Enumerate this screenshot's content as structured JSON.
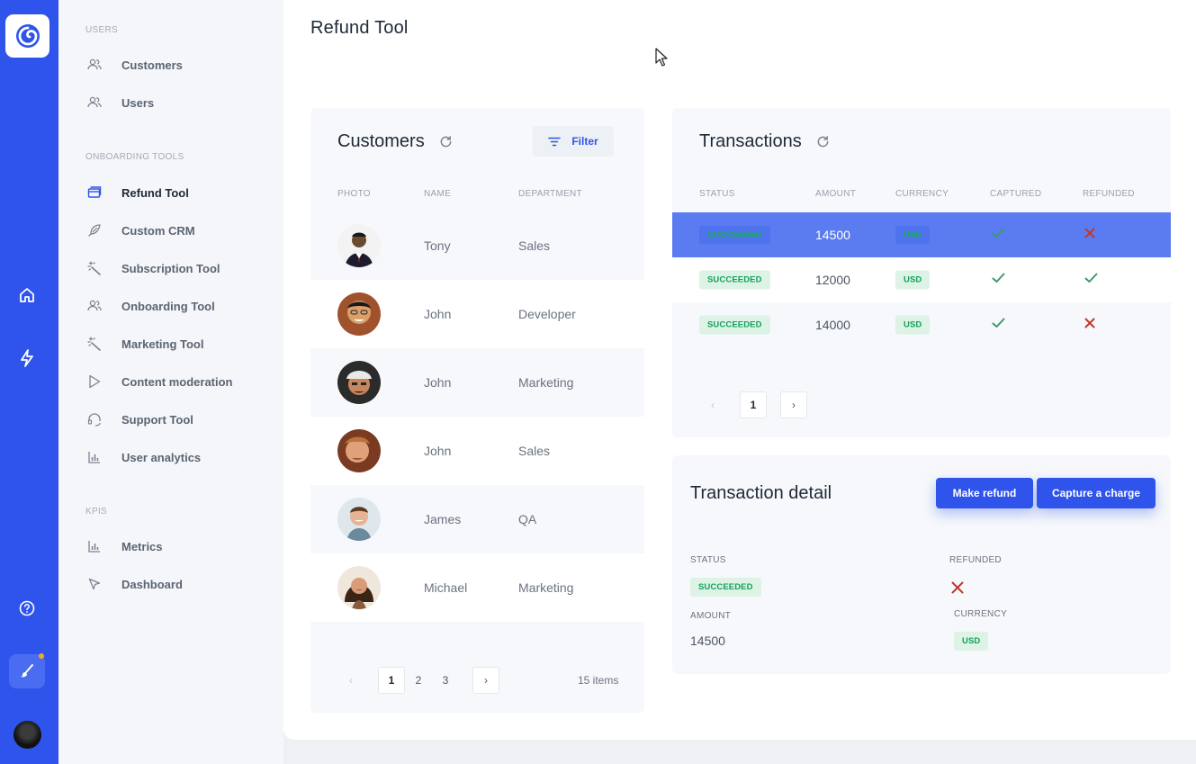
{
  "app": {
    "page_title": "Refund Tool",
    "accent": "#2f54eb",
    "rail_icons": [
      "logo-icon",
      "home-icon",
      "lightning-icon",
      "help-icon",
      "brush-icon",
      "avatar"
    ]
  },
  "sidebar": {
    "sections": [
      {
        "label": "USERS",
        "items": [
          {
            "label": "Customers",
            "icon": "users-icon"
          },
          {
            "label": "Users",
            "icon": "users-icon"
          }
        ]
      },
      {
        "label": "ONBOARDING TOOLS",
        "items": [
          {
            "label": "Refund Tool",
            "icon": "card-icon",
            "active": true
          },
          {
            "label": "Custom CRM",
            "icon": "feather-icon"
          },
          {
            "label": "Subscription Tool",
            "icon": "magic-wand-icon"
          },
          {
            "label": "Onboarding Tool",
            "icon": "users-icon"
          },
          {
            "label": "Marketing Tool",
            "icon": "magic-wand-icon"
          },
          {
            "label": "Content moderation",
            "icon": "play-icon"
          },
          {
            "label": "Support Tool",
            "icon": "headset-icon"
          },
          {
            "label": "User analytics",
            "icon": "bar-chart-icon"
          }
        ]
      },
      {
        "label": "KPIS",
        "items": [
          {
            "label": "Metrics",
            "icon": "bar-chart-icon"
          },
          {
            "label": "Dashboard",
            "icon": "cursor-icon"
          }
        ]
      }
    ]
  },
  "customers": {
    "title": "Customers",
    "filter_label": "Filter",
    "columns": [
      "PHOTO",
      "NAME",
      "DEPARTMENT"
    ],
    "rows": [
      {
        "name": "Tony",
        "department": "Sales"
      },
      {
        "name": "John",
        "department": "Developer"
      },
      {
        "name": "John",
        "department": "Marketing"
      },
      {
        "name": "John",
        "department": "Sales"
      },
      {
        "name": "James",
        "department": "QA"
      },
      {
        "name": "Michael",
        "department": "Marketing"
      }
    ],
    "pagination": {
      "pages": [
        "1",
        "2",
        "3"
      ],
      "current": "1",
      "prev": "‹",
      "next": "›",
      "total_label": "15 items"
    }
  },
  "transactions": {
    "title": "Transactions",
    "columns": [
      "STATUS",
      "AMOUNT",
      "CURRENCY",
      "CAPTURED",
      "REFUNDED"
    ],
    "rows": [
      {
        "status": "SUCCEEDED",
        "amount": "14500",
        "currency": "USD",
        "captured": true,
        "refunded": false,
        "selected": true
      },
      {
        "status": "SUCCEEDED",
        "amount": "12000",
        "currency": "USD",
        "captured": true,
        "refunded": true
      },
      {
        "status": "SUCCEEDED",
        "amount": "14000",
        "currency": "USD",
        "captured": true,
        "refunded": false
      }
    ],
    "pagination": {
      "current": "1",
      "prev": "‹",
      "next": "›"
    }
  },
  "detail": {
    "title": "Transaction detail",
    "make_refund_label": "Make refund",
    "capture_label": "Capture a charge",
    "status_label": "STATUS",
    "status_value": "SUCCEEDED",
    "refunded_label": "REFUNDED",
    "refunded_value": false,
    "amount_label": "AMOUNT",
    "amount_value": "14500",
    "currency_label": "CURRENCY",
    "currency_value": "USD"
  },
  "colors": {
    "success": "#14a05a",
    "check": "#3c9a6a",
    "cross": "#c0392b",
    "selected_row": "#5b7cf0"
  }
}
